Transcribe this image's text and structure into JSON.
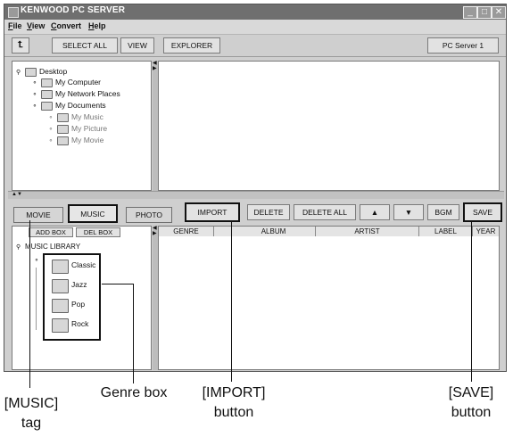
{
  "window": {
    "title": "KENWOOD PC SERVER"
  },
  "menus": [
    {
      "label": "File",
      "key": "F",
      "rest": "ile"
    },
    {
      "label": "View",
      "key": "V",
      "rest": "iew"
    },
    {
      "label": "Convert",
      "key": "C",
      "rest": "onvert"
    },
    {
      "label": "Help",
      "key": "H",
      "rest": "elp"
    }
  ],
  "toolbar": {
    "up_icon": "up-folder-icon",
    "select_all": "SELECT ALL",
    "view": "VIEW",
    "explorer": "EXPLORER",
    "server": "PC Server 1"
  },
  "tree": [
    {
      "label": "Desktop",
      "level": 0
    },
    {
      "label": "My Computer",
      "level": 1
    },
    {
      "label": "My Network Places",
      "level": 1
    },
    {
      "label": "My Documents",
      "level": 1
    },
    {
      "label": "My Music",
      "level": 2
    },
    {
      "label": "My Picture",
      "level": 2
    },
    {
      "label": "My Movie",
      "level": 2
    }
  ],
  "tabs": {
    "movie": "MOVIE",
    "music": "MUSIC",
    "photo": "PHOTO"
  },
  "actions": {
    "import": "IMPORT",
    "delete": "DELETE",
    "delete_all": "DELETE ALL",
    "up": "▲",
    "down": "▼",
    "bgm": "BGM",
    "save": "SAVE"
  },
  "library": {
    "add_box": "ADD BOX",
    "del_box": "DEL BOX",
    "root": "MUSIC LIBRARY",
    "genres": [
      "Classic",
      "Jazz",
      "Pop",
      "Rock"
    ]
  },
  "columns": [
    "GENRE",
    "",
    "ALBUM",
    "ARTIST",
    "LABEL",
    "YEAR"
  ],
  "callouts": {
    "music_tag_1": "[MUSIC]",
    "music_tag_2": "tag",
    "genre_box": "Genre box",
    "import_1": "[IMPORT]",
    "import_2": "button",
    "save_1": "[SAVE]",
    "save_2": "button"
  }
}
